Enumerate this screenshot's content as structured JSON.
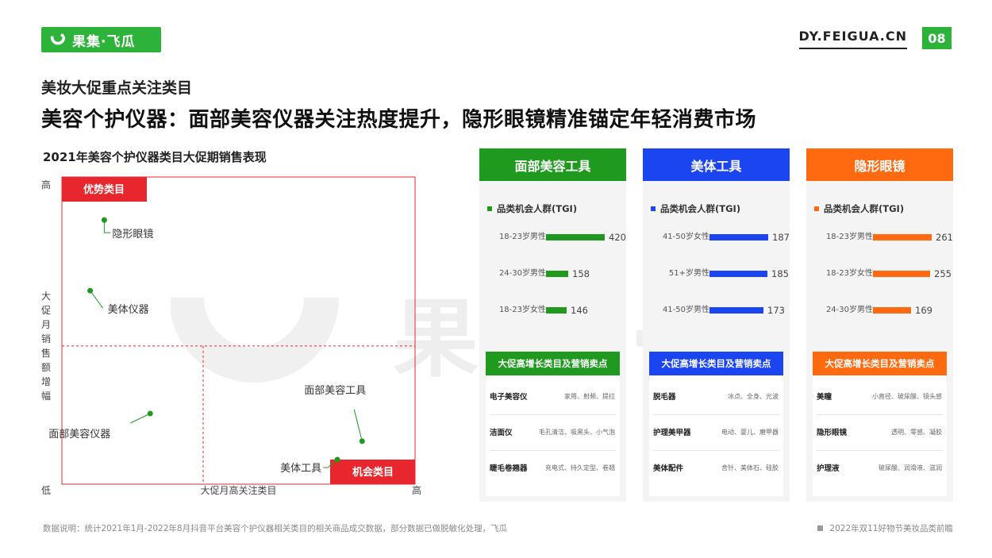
{
  "header": {
    "logo_text": "果集·飞瓜",
    "site": "DY.FEIGUA.CN",
    "page_number": "08",
    "brand_color": "#2db23a"
  },
  "kicker": "美妆大促重点关注类目",
  "headline": "美容个护仪器：面部美容仪器关注热度提升，隐形眼镜精准锚定年轻消费市场",
  "watermark": "果集·飞瓜",
  "chart_data": {
    "type": "scatter",
    "title": "2021年美容个护仪器类目大促期销售表现",
    "xlabel": "大促月高关注类目",
    "ylabel": "大促月销售额增幅",
    "x_low": "低",
    "x_high": "高",
    "y_low": "低",
    "y_high": "高",
    "xlim": [
      0,
      100
    ],
    "ylim": [
      0,
      100
    ],
    "quadrants": {
      "top_left": "优势类目",
      "bottom_right": "机会类目"
    },
    "points": [
      {
        "name": "隐形眼镜",
        "x": 12,
        "y": 86,
        "color": "#1f9a1f"
      },
      {
        "name": "美体仪器",
        "x": 8,
        "y": 63,
        "color": "#1f9a1f"
      },
      {
        "name": "面部美容仪器",
        "x": 25,
        "y": 23,
        "color": "#1f9a1f"
      },
      {
        "name": "面部美容工具",
        "x": 85,
        "y": 14,
        "color": "#1f9a1f"
      },
      {
        "name": "美体工具",
        "x": 78,
        "y": 8,
        "color": "#1f9a1f"
      }
    ]
  },
  "panels": [
    {
      "title": "面部美容工具",
      "color": "#1f9a1f",
      "tgi_title": "品类机会人群(TGI)",
      "tgi_max": 420,
      "tgi": [
        {
          "label": "18-23岁男性",
          "value": 420
        },
        {
          "label": "24-30岁男性",
          "value": 158
        },
        {
          "label": "18-23岁女性",
          "value": 146
        }
      ],
      "promo_title": "大促高增长类目及营销卖点",
      "promo": [
        {
          "name": "电子美容仪",
          "tags": "家用、射频、提拉"
        },
        {
          "name": "洁面仪",
          "tags": "毛孔清洁、吸黑头、小气泡"
        },
        {
          "name": "睫毛卷翘器",
          "tags": "充电式、持久定型、卷翘"
        }
      ]
    },
    {
      "title": "美体工具",
      "color": "#1a45f0",
      "tgi_title": "品类机会人群(TGI)",
      "tgi_max": 187,
      "tgi": [
        {
          "label": "41-50岁女性",
          "value": 187
        },
        {
          "label": "51+岁男性",
          "value": 185
        },
        {
          "label": "41-50岁男性",
          "value": 173
        }
      ],
      "promo_title": "大促高增长类目及营销卖点",
      "promo": [
        {
          "name": "脱毛器",
          "tags": "冰点、全身、光波"
        },
        {
          "name": "护理美甲器",
          "tags": "电动、婴儿、磨甲器"
        },
        {
          "name": "美体配件",
          "tags": "舍针、美体石、硅胶"
        }
      ]
    },
    {
      "title": "隐形眼镜",
      "color": "#ff6a10",
      "tgi_title": "品类机会人群(TGI)",
      "tgi_max": 261,
      "tgi": [
        {
          "label": "18-23岁男性",
          "value": 261
        },
        {
          "label": "18-23岁女性",
          "value": 255
        },
        {
          "label": "24-30岁男性",
          "value": 169
        }
      ],
      "promo_title": "大促高增长类目及营销卖点",
      "promo": [
        {
          "name": "美瞳",
          "tags": "小直径、玻尿酸、镜头感"
        },
        {
          "name": "隐形眼镜",
          "tags": "透明、零感、凝胶"
        },
        {
          "name": "护理液",
          "tags": "玻尿酸、润滑液、滋润"
        }
      ]
    }
  ],
  "footer": {
    "note": "数据说明：统计2021年1月-2022年8月抖音平台美容个护仪器相关类目的相关商品成交数据，部分数据已做脱敏化处理，飞瓜",
    "report": "2022年双11好物节美妆品类前瞻"
  }
}
